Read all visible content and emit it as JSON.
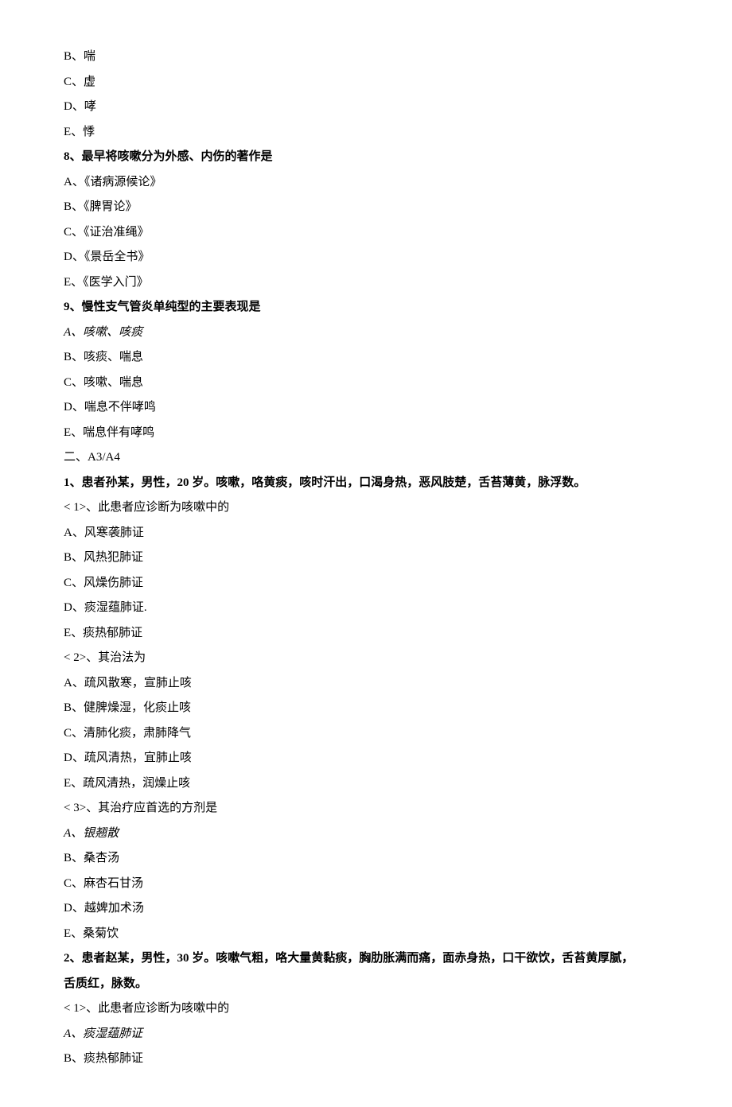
{
  "lines": [
    {
      "text": "B、喘",
      "bold": false,
      "italic": false
    },
    {
      "text": "C、虚",
      "bold": false,
      "italic": false
    },
    {
      "text": "D、哮",
      "bold": false,
      "italic": false
    },
    {
      "text": "E、悸",
      "bold": false,
      "italic": false
    },
    {
      "text": "8、最早将咳嗽分为外感、内伤的著作是",
      "bold": true,
      "italic": false
    },
    {
      "text": "A、《诸病源候论》",
      "bold": false,
      "italic": false
    },
    {
      "text": "B、《脾胃论》",
      "bold": false,
      "italic": false
    },
    {
      "text": "C、《证治准绳》",
      "bold": false,
      "italic": false
    },
    {
      "text": "D、《景岳全书》",
      "bold": false,
      "italic": false
    },
    {
      "text": "E、《医学入门》",
      "bold": false,
      "italic": false
    },
    {
      "text": "9、慢性支气管炎单纯型的主要表现是",
      "bold": true,
      "italic": false
    },
    {
      "text": "A、咳嗽、咳痰",
      "bold": false,
      "italic": true
    },
    {
      "text": "B、咳痰、喘息",
      "bold": false,
      "italic": false
    },
    {
      "text": "C、咳嗽、喘息",
      "bold": false,
      "italic": false
    },
    {
      "text": "D、喘息不伴哮鸣",
      "bold": false,
      "italic": false
    },
    {
      "text": "E、喘息伴有哮鸣",
      "bold": false,
      "italic": false
    },
    {
      "text": "二、A3/A4",
      "bold": false,
      "italic": false
    },
    {
      "text": "1、患者孙某，男性，20 岁。咳嗽，咯黄痰，咳时汗出，口渴身热，恶风肢楚，舌苔薄黄，脉浮数。",
      "bold": true,
      "italic": false
    },
    {
      "text": "<  1>、此患者应诊断为咳嗽中的",
      "bold": false,
      "italic": false
    },
    {
      "text": "A、风寒袭肺证",
      "bold": false,
      "italic": false
    },
    {
      "text": "B、风热犯肺证",
      "bold": false,
      "italic": false
    },
    {
      "text": "C、风燥伤肺证",
      "bold": false,
      "italic": false
    },
    {
      "text": "D、痰湿蕴肺证.",
      "bold": false,
      "italic": false
    },
    {
      "text": "E、痰热郁肺证",
      "bold": false,
      "italic": false
    },
    {
      "text": "<  2>、其治法为",
      "bold": false,
      "italic": false
    },
    {
      "text": "A、疏风散寒，宣肺止咳",
      "bold": false,
      "italic": false
    },
    {
      "text": "B、健脾燥湿，化痰止咳",
      "bold": false,
      "italic": false
    },
    {
      "text": "C、清肺化痰，肃肺降气",
      "bold": false,
      "italic": false
    },
    {
      "text": "D、疏风清热，宜肺止咳",
      "bold": false,
      "italic": false
    },
    {
      "text": "E、疏风清热，润燥止咳",
      "bold": false,
      "italic": false
    },
    {
      "text": "<  3>、其治疗应首选的方剂是",
      "bold": false,
      "italic": false
    },
    {
      "text": "A、银翘散",
      "bold": false,
      "italic": true
    },
    {
      "text": "B、桑杏汤",
      "bold": false,
      "italic": false
    },
    {
      "text": "C、麻杏石甘汤",
      "bold": false,
      "italic": false
    },
    {
      "text": "D、越婢加术汤",
      "bold": false,
      "italic": false
    },
    {
      "text": "E、桑菊饮",
      "bold": false,
      "italic": false
    },
    {
      "text": "2、患者赵某，男性，30 岁。咳嗽气粗，咯大量黄黏痰，胸肋胀满而痛，面赤身热，口干欲饮，舌苔黄厚腻，",
      "bold": true,
      "italic": false
    },
    {
      "text": "舌质红，脉数。",
      "bold": true,
      "italic": false
    },
    {
      "text": "<  1>、此患者应诊断为咳嗽中的",
      "bold": false,
      "italic": false
    },
    {
      "text": "A、痰湿蕴肺证",
      "bold": false,
      "italic": true
    },
    {
      "text": "B、痰热郁肺证",
      "bold": false,
      "italic": false
    }
  ]
}
